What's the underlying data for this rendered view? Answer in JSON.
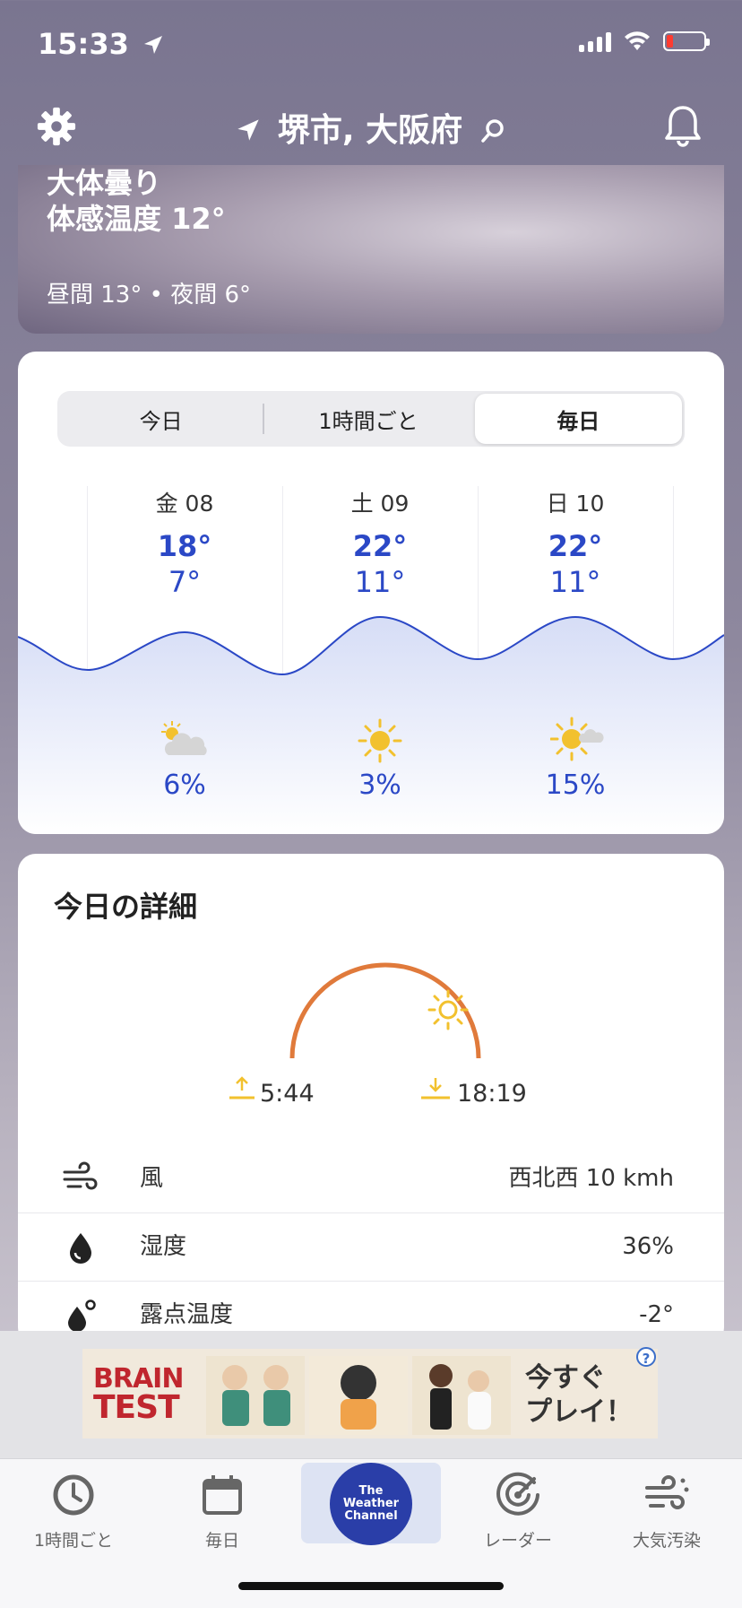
{
  "status": {
    "time": "15:33"
  },
  "header": {
    "location": "堺市, 大阪府"
  },
  "hero": {
    "condition": "大体曇り",
    "feels_like": "体感温度 12°",
    "day_night": "昼間 13° • 夜間 6°"
  },
  "forecast": {
    "tabs": [
      {
        "label": "今日"
      },
      {
        "label": "1時間ごと"
      },
      {
        "label": "毎日"
      }
    ],
    "active_tab": "毎日",
    "days": [
      {
        "label": "金 08",
        "high": "18°",
        "low": "7°",
        "precip": "6%",
        "icon": "partly-cloudy-icon"
      },
      {
        "label": "土 09",
        "high": "22°",
        "low": "11°",
        "precip": "3%",
        "icon": "sunny-icon"
      },
      {
        "label": "日 10",
        "high": "22°",
        "low": "11°",
        "precip": "15%",
        "icon": "mostly-sunny-icon"
      }
    ]
  },
  "details": {
    "title": "今日の詳細",
    "sunrise": "5:44",
    "sunset": "18:19",
    "rows": [
      {
        "label": "風",
        "value": "西北西 10 kmh",
        "icon": "wind-icon"
      },
      {
        "label": "湿度",
        "value": "36%",
        "icon": "humidity-icon"
      },
      {
        "label": "露点温度",
        "value": "-2°",
        "icon": "dew-point-icon"
      }
    ]
  },
  "ad": {
    "brand_line1": "BRAIN",
    "brand_line2": "TEST",
    "cta_line1": "今すぐ",
    "cta_line2": "プレイ！",
    "help": "?"
  },
  "tabbar": {
    "items": [
      {
        "label": "1時間ごと",
        "icon": "clock-icon"
      },
      {
        "label": "毎日",
        "icon": "calendar-icon"
      },
      {
        "label": "The Weather Channel",
        "icon": "twc-logo"
      },
      {
        "label": "レーダー",
        "icon": "radar-icon"
      },
      {
        "label": "大気汚染",
        "icon": "air-quality-icon"
      }
    ],
    "logo_line1": "The",
    "logo_line2": "Weather",
    "logo_line3": "Channel"
  },
  "colors": {
    "accent_blue": "#2b48c6",
    "sun_arc": "#e07a3b",
    "sun_yellow": "#f2c12e"
  }
}
